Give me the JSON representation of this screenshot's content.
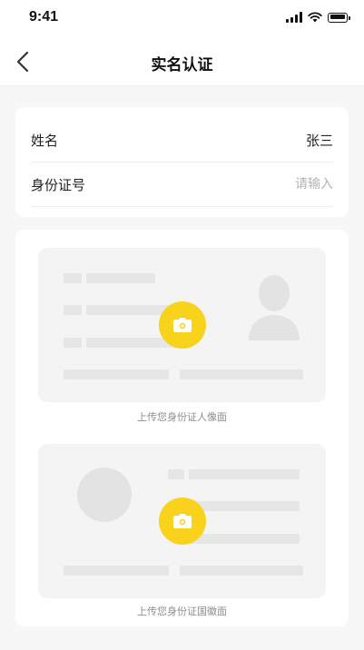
{
  "status_bar": {
    "time": "9:41"
  },
  "nav": {
    "title": "实名认证",
    "back_icon": "chevron-left-icon"
  },
  "form": {
    "name_label": "姓名",
    "name_value": "张三",
    "id_label": "身份证号",
    "id_placeholder": "请输入",
    "id_value": ""
  },
  "upload": {
    "front_caption": "上传您身份证人像面",
    "back_caption": "上传您身份证国徽面",
    "camera_icon": "camera-icon"
  },
  "colors": {
    "accent": "#f9d21c",
    "page_bg": "#f7f7f8",
    "placeholder_bar": "#e6e6e6"
  }
}
